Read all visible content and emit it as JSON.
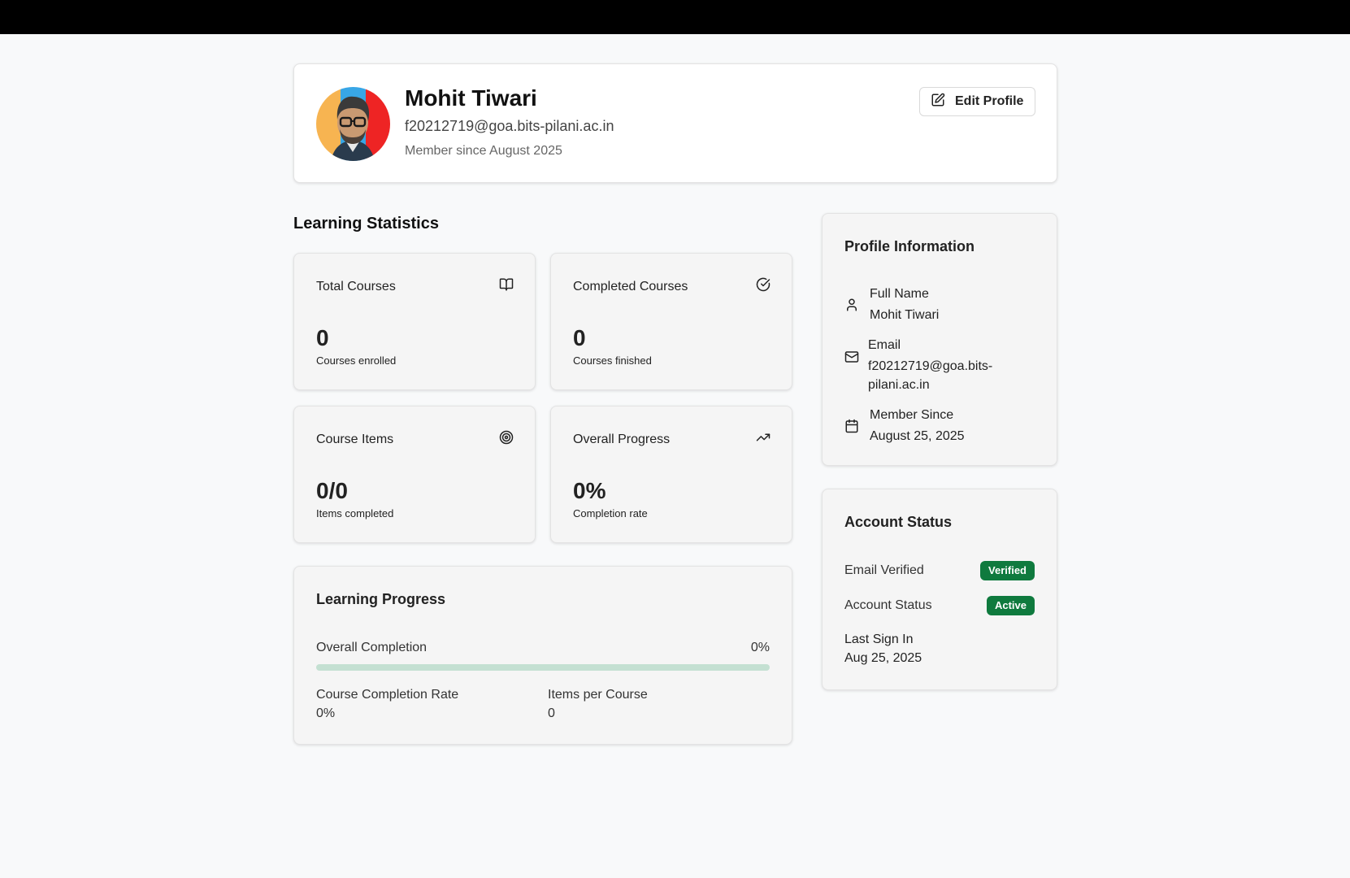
{
  "profile": {
    "name": "Mohit Tiwari",
    "email": "f20212719@goa.bits-pilani.ac.in",
    "member_since": "Member since August 2025",
    "edit_label": "Edit Profile",
    "avatar_icon": "avatar-illustration"
  },
  "stats": {
    "title": "Learning Statistics",
    "total_courses": {
      "label": "Total Courses",
      "value": "0",
      "sub": "Courses enrolled",
      "icon": "book-icon"
    },
    "completed_courses": {
      "label": "Completed Courses",
      "value": "0",
      "sub": "Courses finished",
      "icon": "check-circle-icon"
    },
    "course_items": {
      "label": "Course Items",
      "value": "0/0",
      "sub": "Items completed",
      "icon": "target-icon"
    },
    "overall_progress": {
      "label": "Overall Progress",
      "value": "0%",
      "sub": "Completion rate",
      "icon": "trending-up-icon"
    }
  },
  "learning_progress": {
    "title": "Learning Progress",
    "overall_label": "Overall Completion",
    "overall_value": "0%",
    "overall_fraction": 0,
    "rate_label": "Course Completion Rate",
    "rate_value": "0%",
    "items_label": "Items per Course",
    "items_value": "0"
  },
  "profile_info": {
    "title": "Profile Information",
    "full_name_label": "Full Name",
    "full_name_value": "Mohit Tiwari",
    "email_label": "Email",
    "email_value": "f20212719@goa.bits-pilani.ac.in",
    "since_label": "Member Since",
    "since_value": "August 25, 2025"
  },
  "account_status": {
    "title": "Account Status",
    "email_verified_label": "Email Verified",
    "email_verified_badge": "Verified",
    "account_status_label": "Account Status",
    "account_status_badge": "Active",
    "last_sign_in_label": "Last Sign In",
    "last_sign_in_value": "Aug 25, 2025",
    "badge_color": "#0f7a3e"
  }
}
